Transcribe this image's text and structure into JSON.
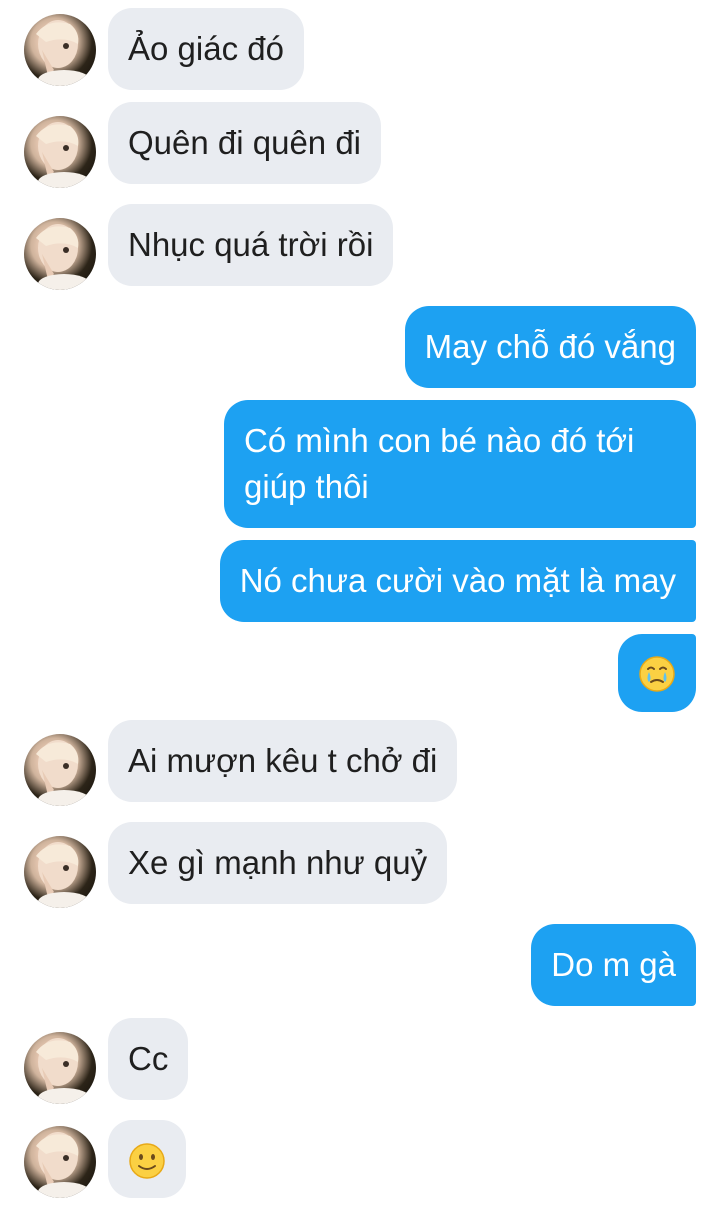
{
  "conversation": {
    "messages": [
      {
        "sender": "contact",
        "text": "Ảo giác đó"
      },
      {
        "sender": "contact",
        "text": "Quên đi quên đi"
      },
      {
        "sender": "contact",
        "text": "Nhục quá trời rồi"
      },
      {
        "sender": "me",
        "text": "May chỗ đó vắng"
      },
      {
        "sender": "me",
        "text": "Có mình con bé nào đó tới giúp thôi"
      },
      {
        "sender": "me",
        "text": "Nó chưa cười vào mặt là may"
      },
      {
        "sender": "me",
        "emoji": "face-holding-back-tears-icon"
      },
      {
        "sender": "contact",
        "text": "Ai mượn kêu t chở đi"
      },
      {
        "sender": "contact",
        "text": "Xe gì mạnh như quỷ"
      },
      {
        "sender": "me",
        "text": "Do m gà"
      },
      {
        "sender": "contact",
        "text": "Cc"
      },
      {
        "sender": "contact",
        "emoji": "slightly-smiling-face-icon"
      }
    ]
  },
  "colors": {
    "incoming_bubble": "#e9ecf1",
    "outgoing_bubble": "#1da1f2",
    "incoming_text": "#1f1f1f",
    "outgoing_text": "#ffffff"
  }
}
